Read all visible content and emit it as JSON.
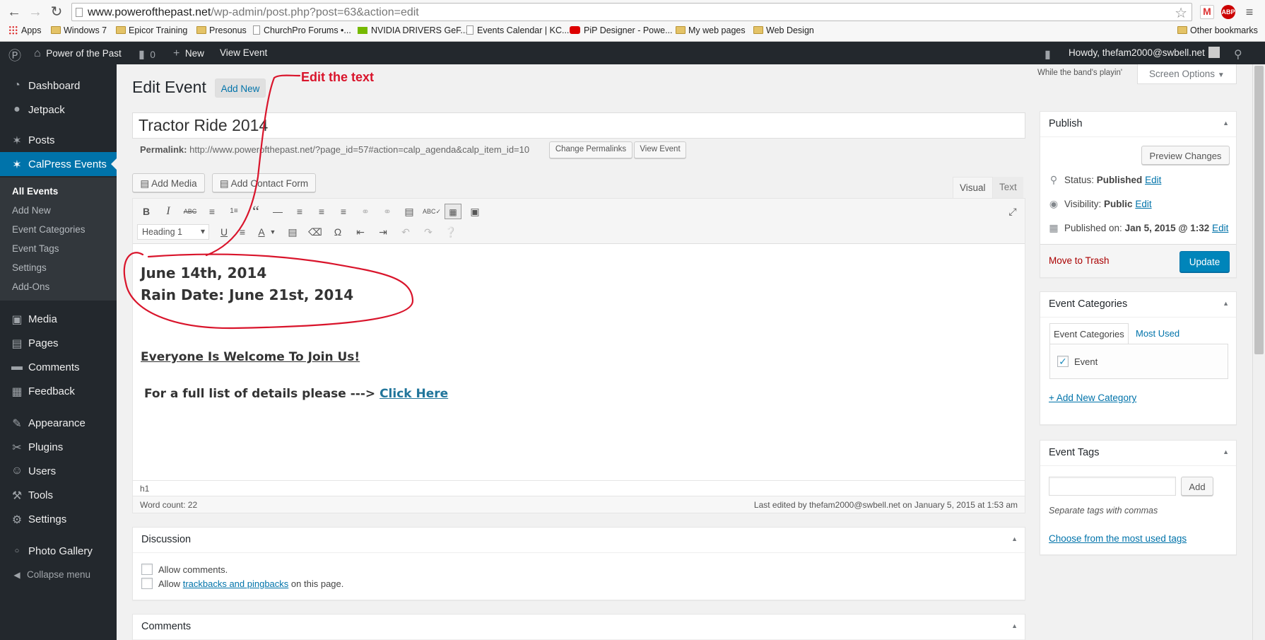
{
  "browser": {
    "url_host": "www.powerofthepast.net",
    "url_path": "/wp-admin/post.php?post=63&action=edit",
    "bookmarks": [
      "Apps",
      "Windows 7",
      "Epicor Training",
      "Presonus",
      "ChurchPro Forums •...",
      "NVIDIA DRIVERS GeF...",
      "Events Calendar | KC...",
      "PiP Designer - Powe...",
      "My web pages",
      "Web Design",
      "Other bookmarks"
    ],
    "ext_abp": "ABP"
  },
  "adminbar": {
    "site_name": "Power of the Past",
    "comments_count": "0",
    "new_label": "New",
    "view_label": "View Event",
    "howdy": "Howdy, thefam2000@swbell.net"
  },
  "sidebar": {
    "items": [
      {
        "label": "Dashboard",
        "icon": "dashboard-icon",
        "glyph": "◔"
      },
      {
        "label": "Jetpack",
        "icon": "jetpack-icon",
        "glyph": "●"
      },
      {
        "label": "Posts",
        "icon": "pin-icon",
        "glyph": "✶"
      },
      {
        "label": "CalPress Events",
        "icon": "pin-icon",
        "glyph": "✶"
      },
      {
        "label": "Media",
        "icon": "media-icon",
        "glyph": "▣"
      },
      {
        "label": "Pages",
        "icon": "pages-icon",
        "glyph": "▤"
      },
      {
        "label": "Comments",
        "icon": "comment-icon",
        "glyph": "▬"
      },
      {
        "label": "Feedback",
        "icon": "feedback-icon",
        "glyph": "▦"
      },
      {
        "label": "Appearance",
        "icon": "brush-icon",
        "glyph": "✎"
      },
      {
        "label": "Plugins",
        "icon": "plug-icon",
        "glyph": "✂"
      },
      {
        "label": "Users",
        "icon": "user-icon",
        "glyph": "☺"
      },
      {
        "label": "Tools",
        "icon": "wrench-icon",
        "glyph": "⚒"
      },
      {
        "label": "Settings",
        "icon": "settings-icon",
        "glyph": "⚙"
      },
      {
        "label": "Photo Gallery",
        "icon": "gallery-icon",
        "glyph": "○"
      },
      {
        "label": "Collapse menu",
        "icon": "collapse-icon",
        "glyph": "◀"
      }
    ],
    "submenu": [
      "All Events",
      "Add New",
      "Event Categories",
      "Event Tags",
      "Settings",
      "Add-Ons"
    ]
  },
  "page": {
    "title": "Edit Event",
    "add_new": "Add New",
    "screen_hint": "While the band's playin'",
    "screen_options": "Screen Options"
  },
  "post": {
    "title": "Tractor Ride 2014",
    "permalink_label": "Permalink:",
    "permalink_url": "http://www.powerofthepast.net/?page_id=57#action=calp_agenda&calp_item_id=10",
    "change_permalinks": "Change Permalinks",
    "view_event": "View Event"
  },
  "editor": {
    "add_media": "Add Media",
    "add_contact_form": "Add Contact Form",
    "tab_visual": "Visual",
    "tab_text": "Text",
    "format": "Heading 1",
    "line1": "June 14th, 2014",
    "line2": "Rain Date: June 21st, 2014",
    "welcome": "Everyone Is Welcome To Join Us!",
    "details": "For a full list of details please --->",
    "click_here": "Click Here",
    "path": "h1",
    "word_count": "Word count: 22",
    "last_edited": "Last edited by thefam2000@swbell.net on January 5, 2015 at 1:53 am"
  },
  "publish": {
    "title": "Publish",
    "preview": "Preview Changes",
    "status_label": "Status:",
    "status_value": "Published",
    "visibility_label": "Visibility:",
    "visibility_value": "Public",
    "published_label": "Published on:",
    "published_value": "Jan 5, 2015 @ 1:32",
    "edit": "Edit",
    "trash": "Move to Trash",
    "update": "Update"
  },
  "categories": {
    "title": "Event Categories",
    "tab_all": "Event Categories",
    "tab_used": "Most Used",
    "item": "Event",
    "add_new": "+ Add New Category"
  },
  "tags": {
    "title": "Event Tags",
    "add": "Add",
    "hint": "Separate tags with commas",
    "choose": "Choose from the most used tags"
  },
  "discussion": {
    "title": "Discussion",
    "allow_comments": "Allow comments.",
    "allow_pre": "Allow",
    "allow_link": "trackbacks and pingbacks",
    "allow_post": "on this page."
  },
  "comments_box": {
    "title": "Comments"
  },
  "annotation": {
    "text": "Edit the text",
    "color": "#d9142b"
  }
}
